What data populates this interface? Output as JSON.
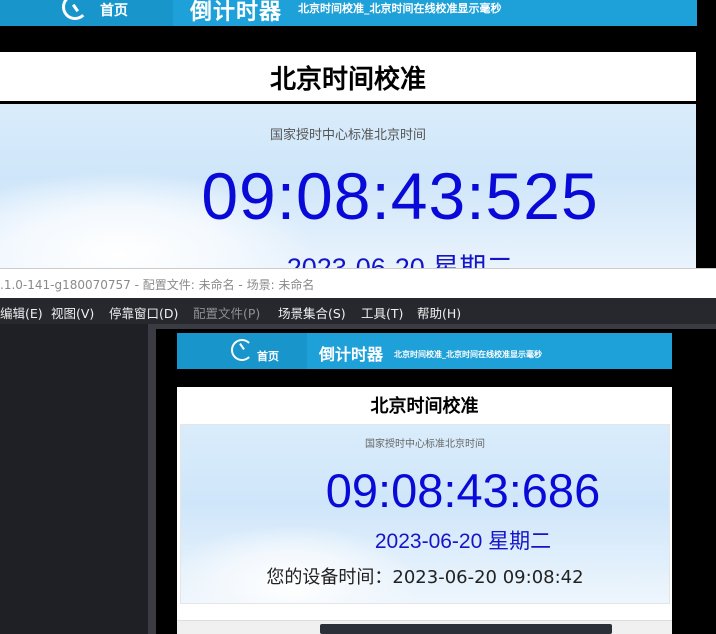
{
  "top_capture": {
    "nav": {
      "home_label": "首页",
      "brand": "倒计时器",
      "tagline": "北京时间校准_北京时间在线校准显示毫秒"
    },
    "page_title": "北京时间校准",
    "panel_header": "国家授时中心标准北京时间",
    "time": "09:08:43:525",
    "date": "2023-06-20 星期二"
  },
  "app": {
    "title": ".1.0-141-g180070757 - 配置文件: 未命名 - 场景: 未命名",
    "menu": [
      {
        "label": "编辑(E)",
        "enabled": true
      },
      {
        "label": "视图(V)",
        "enabled": true
      },
      {
        "label": "停靠窗口(D)",
        "enabled": true
      },
      {
        "label": "配置文件(P)",
        "enabled": false
      },
      {
        "label": "场景集合(S)",
        "enabled": true
      },
      {
        "label": "工具(T)",
        "enabled": true
      },
      {
        "label": "帮助(H)",
        "enabled": true
      }
    ]
  },
  "preview_capture": {
    "nav": {
      "home_label": "首页",
      "brand": "倒计时器",
      "tagline": "北京时间校准_北京时间在线校准显示毫秒"
    },
    "page_title": "北京时间校准",
    "panel_header": "国家授时中心标准北京时间",
    "time": "09:08:43:686",
    "date": "2023-06-20 星期二",
    "device_time": "您的设备时间：2023-06-20 09:08:42"
  },
  "colors": {
    "nav_blue": "#1ea0d8",
    "time_blue": "#0a0ad8",
    "menubar_bg": "#27282e"
  }
}
